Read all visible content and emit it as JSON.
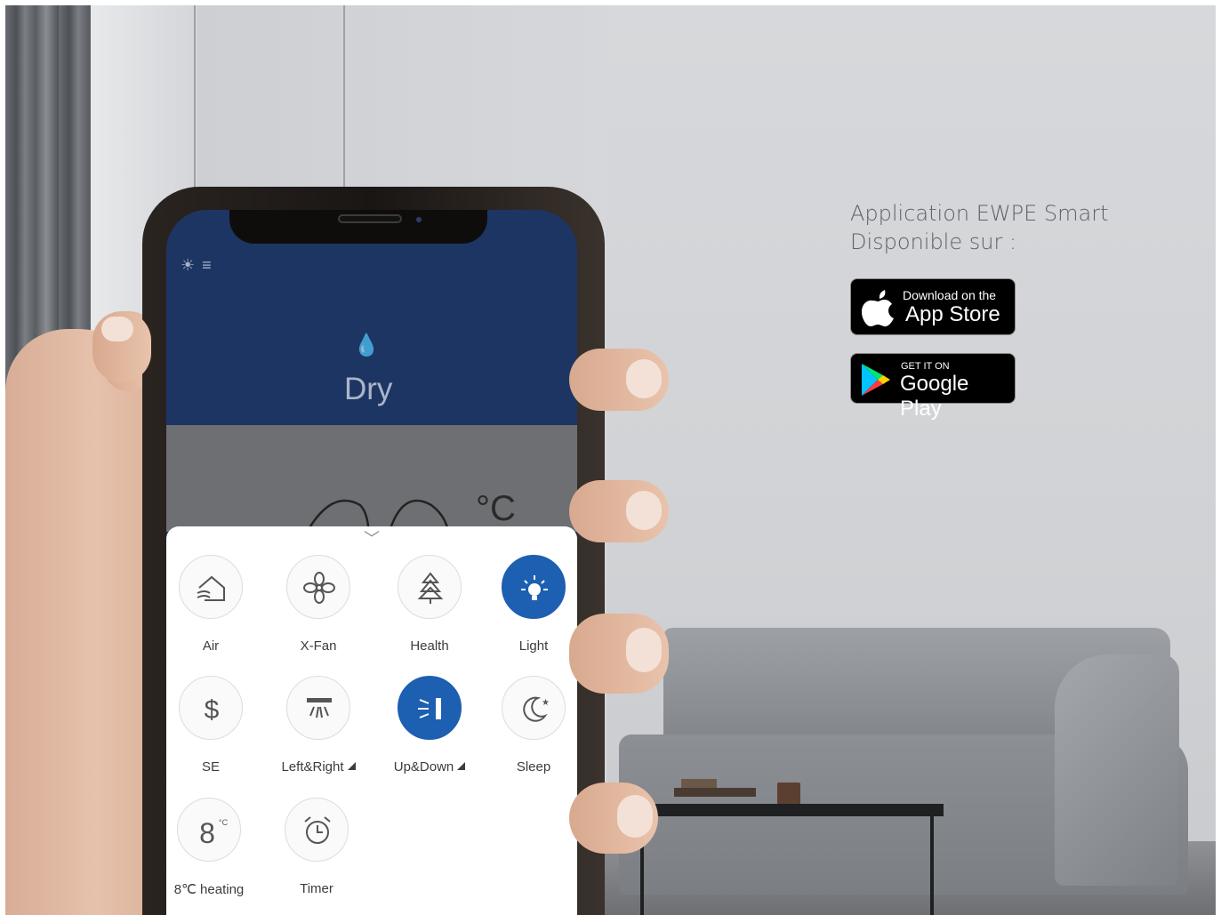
{
  "app": {
    "mode_label": "Dry",
    "temperature_unit": "°C"
  },
  "functions": [
    {
      "label": "Air",
      "icon": "air-icon",
      "active": false
    },
    {
      "label": "X-Fan",
      "icon": "fan-icon",
      "active": false
    },
    {
      "label": "Health",
      "icon": "tree-icon",
      "active": false
    },
    {
      "label": "Light",
      "icon": "light-icon",
      "active": true
    },
    {
      "label": "SE",
      "icon": "dollar-icon",
      "active": false
    },
    {
      "label": "Left&Right",
      "icon": "swing-horizontal-icon",
      "active": false
    },
    {
      "label": "Up&Down",
      "icon": "swing-vertical-icon",
      "active": true
    },
    {
      "label": "Sleep",
      "icon": "moon-icon",
      "active": false
    },
    {
      "label": "8℃ heating",
      "icon": "heating-8-icon",
      "active": false
    },
    {
      "label": "Timer",
      "icon": "alarm-clock-icon",
      "active": false
    }
  ],
  "promo": {
    "title_line1": "Application EWPE Smart",
    "title_line2": "Disponible sur :"
  },
  "app_store": {
    "small_text": "Download on the",
    "large_text": "App Store"
  },
  "google_play": {
    "small_text": "GET IT ON",
    "large_text": "Google Play"
  },
  "colors": {
    "accent_blue": "#1d5fb0",
    "header_navy": "#1d3563"
  }
}
